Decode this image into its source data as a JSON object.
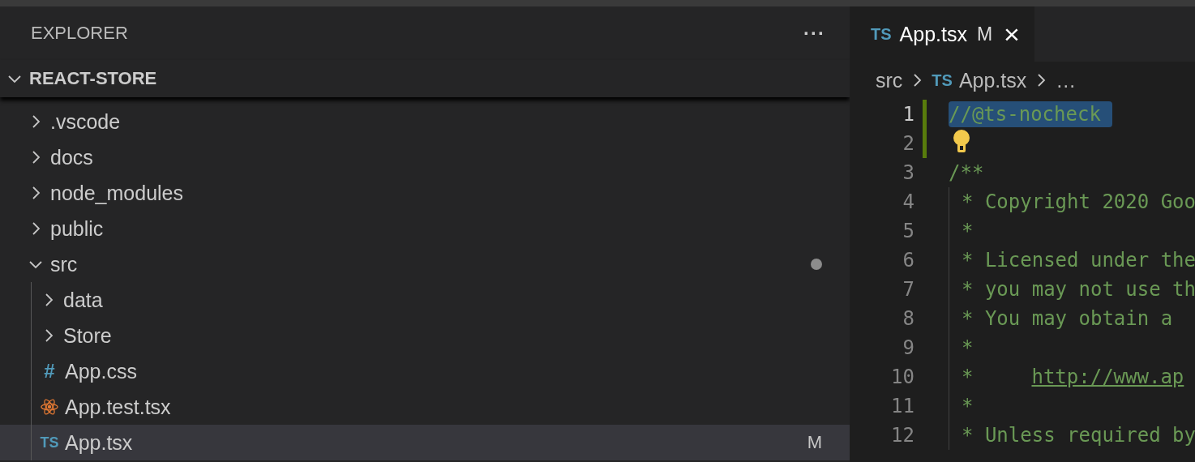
{
  "sidebar": {
    "title": "EXPLORER",
    "more": "···",
    "root": {
      "label": "REACT-STORE",
      "expanded": true
    },
    "tree": [
      {
        "label": ".vscode",
        "kind": "folder",
        "expanded": false,
        "selected": false
      },
      {
        "label": "docs",
        "kind": "folder",
        "expanded": false,
        "selected": false
      },
      {
        "label": "node_modules",
        "kind": "folder",
        "expanded": false,
        "selected": false
      },
      {
        "label": "public",
        "kind": "folder",
        "expanded": false,
        "selected": false
      },
      {
        "label": "src",
        "kind": "folder",
        "expanded": true,
        "selected": false,
        "dot": true,
        "children": [
          {
            "label": "data",
            "kind": "folder",
            "expanded": false,
            "selected": false
          },
          {
            "label": "Store",
            "kind": "folder",
            "expanded": false,
            "selected": false
          },
          {
            "label": "App.css",
            "kind": "css",
            "icon_text": "#",
            "selected": false
          },
          {
            "label": "App.test.tsx",
            "kind": "react",
            "selected": false
          },
          {
            "label": "App.tsx",
            "kind": "ts",
            "icon_text": "TS",
            "selected": true,
            "badge": "M"
          }
        ]
      }
    ]
  },
  "editor": {
    "tabs": [
      {
        "icon_text": "TS",
        "label": "App.tsx",
        "badge": "M",
        "close": "×",
        "selected": true
      }
    ],
    "breadcrumb": [
      {
        "text": "src",
        "kind": "folder"
      },
      {
        "text": "App.tsx",
        "kind": "ts",
        "icon_text": "TS"
      },
      {
        "text": "…",
        "kind": "more"
      }
    ],
    "lines": [
      {
        "number": "1",
        "kind": "selected",
        "modified": true,
        "text": "//@ts-nocheck"
      },
      {
        "number": "2",
        "kind": "lightbulb",
        "modified": true
      },
      {
        "number": "3",
        "kind": "plain",
        "modified": false,
        "text": "/**"
      },
      {
        "number": "4",
        "kind": "doc",
        "modified": false,
        "text": "* Copyright 2020 Goo"
      },
      {
        "number": "5",
        "kind": "doc",
        "modified": false,
        "text": "*"
      },
      {
        "number": "6",
        "kind": "doc",
        "modified": false,
        "text": "* Licensed under the"
      },
      {
        "number": "7",
        "kind": "doc",
        "modified": false,
        "text": "* you may not use th"
      },
      {
        "number": "8",
        "kind": "doc",
        "modified": false,
        "text": "* You may obtain a"
      },
      {
        "number": "9",
        "kind": "doc",
        "modified": false,
        "text": "*"
      },
      {
        "number": "10",
        "kind": "doc",
        "modified": false,
        "text": "*",
        "link": "http://www.ap"
      },
      {
        "number": "11",
        "kind": "doc",
        "modified": false,
        "text": "*"
      },
      {
        "number": "12",
        "kind": "doc",
        "modified": false,
        "text": "* Unless required by"
      }
    ]
  }
}
